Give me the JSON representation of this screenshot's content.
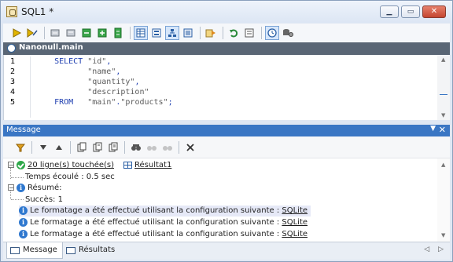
{
  "window": {
    "title": "SQL1 *",
    "minimize": "▁",
    "maximize": "▭",
    "close": "✕"
  },
  "toolbar": {
    "icons": [
      "execute-icon",
      "execute-step-icon",
      "toggle-comment-icon",
      "uncomment-icon",
      "expand-icon",
      "collapse-icon",
      "block-icon",
      "grid-view-icon",
      "form-view-icon",
      "tree-view-icon",
      "text-view-icon",
      "export-icon",
      "undo-icon",
      "options-icon",
      "clock-icon",
      "db-settings-icon"
    ]
  },
  "editor": {
    "header": "Nanonull.main",
    "line_numbers": [
      "1",
      "2",
      "3",
      "4",
      "5"
    ],
    "lines": [
      [
        {
          "t": "    SELECT ",
          "c": "kw"
        },
        {
          "t": "\"id\"",
          "c": "str"
        },
        {
          "t": ",",
          "c": "pun"
        }
      ],
      [
        {
          "t": "           \"name\"",
          "c": "str"
        },
        {
          "t": ",",
          "c": "pun"
        }
      ],
      [
        {
          "t": "           \"quantity\"",
          "c": "str"
        },
        {
          "t": ",",
          "c": "pun"
        }
      ],
      [
        {
          "t": "           \"description\"",
          "c": "str"
        }
      ],
      [
        {
          "t": "    FROM   ",
          "c": "kw"
        },
        {
          "t": "\"main\"",
          "c": "str"
        },
        {
          "t": ".",
          "c": "pun"
        },
        {
          "t": "\"products\"",
          "c": "str"
        },
        {
          "t": ";",
          "c": "pun"
        }
      ]
    ]
  },
  "message_panel": {
    "title": "Message",
    "dropdown": "▼",
    "close": "✕",
    "rows": {
      "rows_affected": "20 ligne(s) touchée(s)",
      "result_link": "Résultat1",
      "elapsed": "Temps écoulé : 0.5 sec",
      "summary": "Résumé:",
      "success": "Succès: 1",
      "info_text": "Le formatage a été effectué utilisant la configuration suivante : ",
      "info_link": "SQLite"
    }
  },
  "tabs": {
    "message": "Message",
    "results": "Résultats",
    "prev": "◁",
    "next": "▷"
  },
  "colors": {
    "panel_title": "#3a76c4",
    "editor_header": "#5a6675",
    "keyword": "#1f3fb0"
  }
}
